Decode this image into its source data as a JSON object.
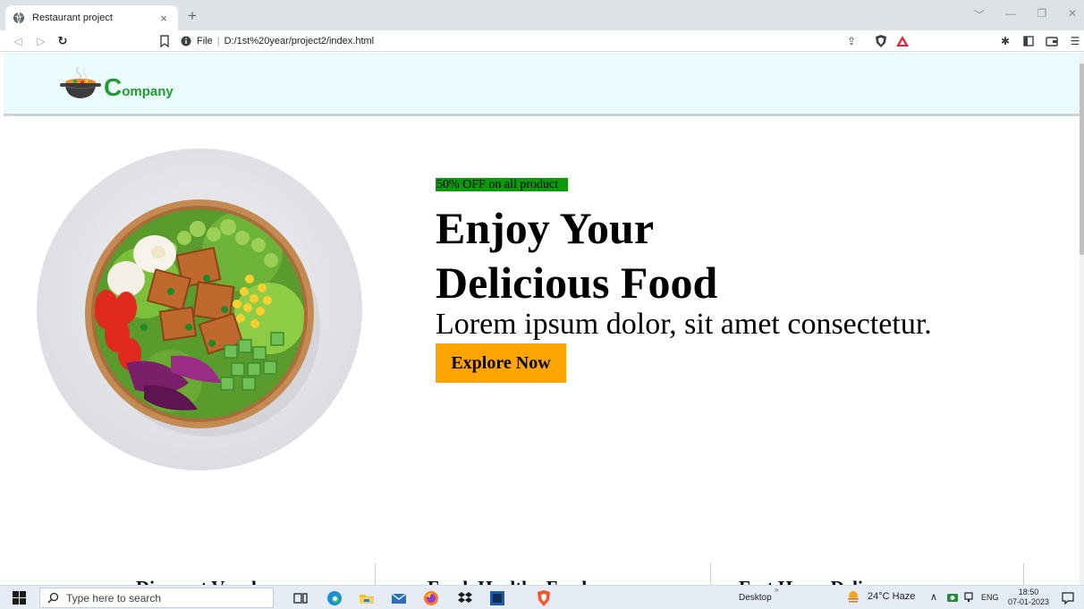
{
  "browser": {
    "tab_title": "Restaurant project",
    "tab_close": "×",
    "new_tab": "+",
    "window_controls": [
      "﹀",
      "—",
      "❐",
      "✕"
    ],
    "url_scheme": "File",
    "url_separator": "|",
    "url_path": "D:/1st%20year/project2/index.html"
  },
  "site": {
    "logo_initial": "C",
    "logo_rest": "ompany",
    "offer_text": "50% OFF on all product",
    "hero_title_line1": "Enjoy Your",
    "hero_title_line2": "Delicious Food",
    "hero_subtitle": "Lorem ipsum dolor, sit amet consectetur.",
    "explore_button": "Explore Now",
    "features": [
      "Discount Voucher",
      "Fresh Healthy Food",
      "Fast Home Delivery"
    ],
    "colors": {
      "header_bg": "#e9fbfd",
      "logo_green": "#1f9e2c",
      "offer_bg": "#0a9a0a",
      "button_orange": "#ffa500"
    }
  },
  "taskbar": {
    "search_placeholder": "Type here to search",
    "desktop_label": "Desktop",
    "weather": "24°C  Haze",
    "language": "ENG",
    "time": "18:50",
    "date": "07-01-2023"
  }
}
